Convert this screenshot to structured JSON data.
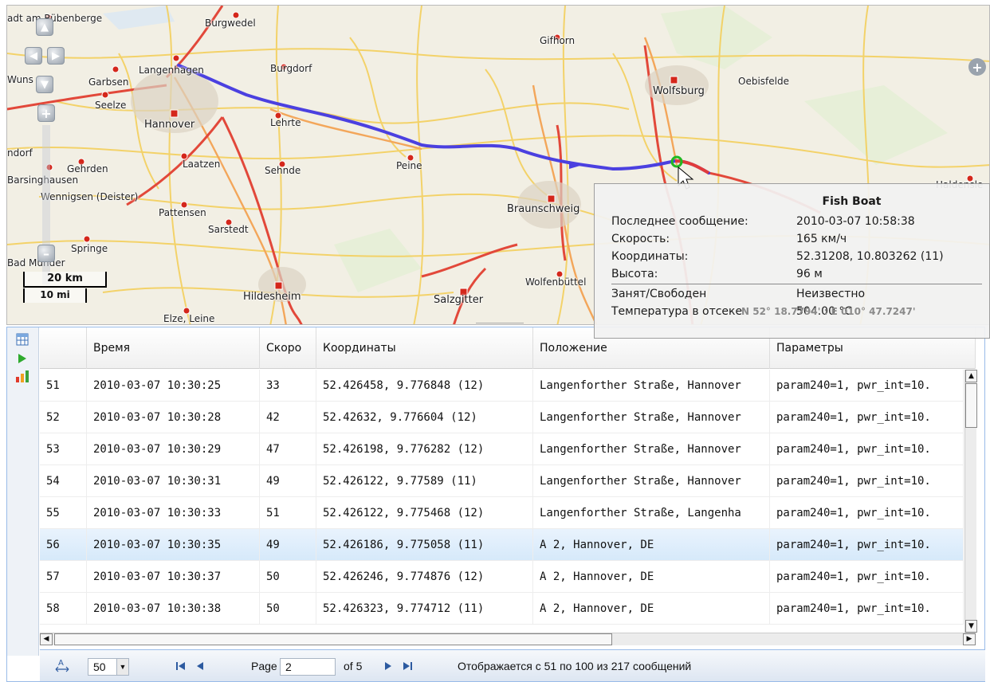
{
  "map": {
    "cities": [
      {
        "name": "Neustadt am Rübenberge",
        "label": "adt am Rübenberge"
      },
      {
        "name": "Burgwedel",
        "label": "Burgwedel"
      },
      {
        "name": "Gifhorn",
        "label": "Gifhorn"
      },
      {
        "name": "Wunstorf",
        "label": "Wuns"
      },
      {
        "name": "Garbsen",
        "label": "Garbsen"
      },
      {
        "name": "Langenhagen",
        "label": "Langenhagen"
      },
      {
        "name": "Burgdorf",
        "label": "Burgdorf"
      },
      {
        "name": "Wolfsburg",
        "label": "Wolfsburg"
      },
      {
        "name": "Oebisfelde",
        "label": "Oebisfelde"
      },
      {
        "name": "Seelze",
        "label": "Seelze"
      },
      {
        "name": "Hannover",
        "label": "Hannover"
      },
      {
        "name": "Lehrte",
        "label": "Lehrte"
      },
      {
        "name": "Landorf",
        "label": "ndorf"
      },
      {
        "name": "Gehrden",
        "label": "Gehrden"
      },
      {
        "name": "Laatzen",
        "label": "Laatzen"
      },
      {
        "name": "Sehnde",
        "label": "Sehnde"
      },
      {
        "name": "Peine",
        "label": "Peine"
      },
      {
        "name": "Barsinghausen",
        "label": "Barsinghausen"
      },
      {
        "name": "Wennigsen (Deister)",
        "label": "Wennigsen (Deister)"
      },
      {
        "name": "Pattensen",
        "label": "Pattensen"
      },
      {
        "name": "Braunschweig",
        "label": "Braunschweig"
      },
      {
        "name": "Sarstedt",
        "label": "Sarstedt"
      },
      {
        "name": "Springe",
        "label": "Springe"
      },
      {
        "name": "Bad Münder",
        "label": "Bad Münder"
      },
      {
        "name": "Hildesheim",
        "label": "Hildesheim"
      },
      {
        "name": "Salzgitter",
        "label": "Salzgitter"
      },
      {
        "name": "Wolfenbüttel",
        "label": "Wolfenbüttel"
      },
      {
        "name": "Elze, Leine",
        "label": "Elze, Leine"
      },
      {
        "name": "Haldensleben",
        "label": "Haldensle"
      }
    ],
    "scale_km": "20 km",
    "scale_mi": "10 mi",
    "colors": {
      "track": "#4b40e0",
      "marker": "#22b822"
    }
  },
  "tooltip": {
    "title": "Fish Boat",
    "rows": [
      {
        "key": "Последнее сообщение:",
        "value": "2010-03-07 10:58:38"
      },
      {
        "key": "Скорость:",
        "value": "165 км/ч"
      },
      {
        "key": "Координаты:",
        "value": "52.31208, 10.803262 (11)"
      },
      {
        "key": "Высота:",
        "value": "96 м"
      },
      {
        "key": "Занят/Свободен",
        "value": "Неизвестно"
      },
      {
        "key": "Температура в отсеке",
        "value": "504.00 °C"
      }
    ],
    "coords_overlay": "N 52° 18.7794' : E 010° 47.7247'"
  },
  "grid": {
    "columns": [
      "",
      "Время",
      "Скоро",
      "Координаты",
      "Положение",
      "Параметры"
    ],
    "rows": [
      {
        "n": "51",
        "time": "2010-03-07 10:30:25",
        "speed": "33",
        "coords": "52.426458, 9.776848 (12)",
        "place": "Langenforther Straße, Hannover",
        "params": "param240=1, pwr_int=10."
      },
      {
        "n": "52",
        "time": "2010-03-07 10:30:28",
        "speed": "42",
        "coords": "52.42632, 9.776604 (12)",
        "place": "Langenforther Straße, Hannover",
        "params": "param240=1, pwr_int=10."
      },
      {
        "n": "53",
        "time": "2010-03-07 10:30:29",
        "speed": "47",
        "coords": "52.426198, 9.776282 (12)",
        "place": "Langenforther Straße, Hannover",
        "params": "param240=1, pwr_int=10."
      },
      {
        "n": "54",
        "time": "2010-03-07 10:30:31",
        "speed": "49",
        "coords": "52.426122, 9.77589 (11)",
        "place": "Langenforther Straße, Hannover",
        "params": "param240=1, pwr_int=10."
      },
      {
        "n": "55",
        "time": "2010-03-07 10:30:33",
        "speed": "51",
        "coords": "52.426122, 9.775468 (12)",
        "place": "Langenforther Straße, Langenha",
        "params": "param240=1, pwr_int=10."
      },
      {
        "n": "56",
        "time": "2010-03-07 10:30:35",
        "speed": "49",
        "coords": "52.426186, 9.775058 (11)",
        "place": "A 2, Hannover, DE",
        "params": "param240=1, pwr_int=10.",
        "selected": true
      },
      {
        "n": "57",
        "time": "2010-03-07 10:30:37",
        "speed": "50",
        "coords": "52.426246, 9.774876 (12)",
        "place": "A 2, Hannover, DE",
        "params": "param240=1, pwr_int=10."
      },
      {
        "n": "58",
        "time": "2010-03-07 10:30:38",
        "speed": "50",
        "coords": "52.426323, 9.774712 (11)",
        "place": "A 2, Hannover, DE",
        "params": "param240=1, pwr_int=10."
      }
    ],
    "selected_color": "#dfe8f6"
  },
  "pager": {
    "page_size": "50",
    "page_label": "Page",
    "page_value": "2",
    "of_label": "of 5",
    "status": "Отображается с 51 по 100 из 217 сообщений"
  },
  "icons": {
    "table": "table-icon",
    "play": "play-icon",
    "chart": "chart-icon",
    "autosize": "autosize-icon",
    "first": "first-page-icon",
    "prev": "prev-page-icon",
    "next": "next-page-icon",
    "last": "last-page-icon"
  }
}
